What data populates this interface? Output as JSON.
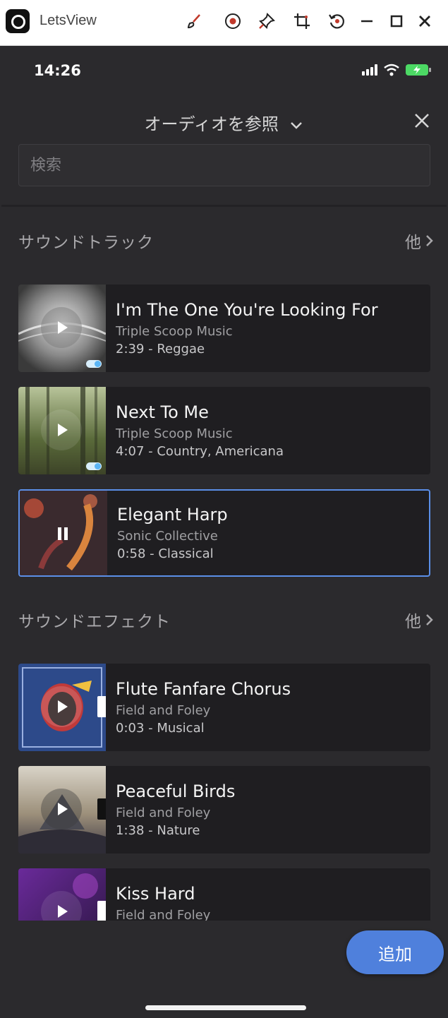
{
  "window": {
    "title": "LetsView",
    "toolbar_icons": [
      "brush-icon",
      "record-icon",
      "pin-icon",
      "crop-icon",
      "rotate-icon",
      "minimize-icon",
      "maximize-icon",
      "close-icon"
    ]
  },
  "status": {
    "time": "14:26"
  },
  "header": {
    "title": "オーディオを参照",
    "close_icon": "close-icon"
  },
  "search": {
    "placeholder": "検索",
    "value": ""
  },
  "soundtracks": {
    "title": "サウンドトラック",
    "more": "他",
    "items": [
      {
        "title": "I'm The One You're Looking For",
        "artist": "Triple Scoop Music",
        "meta": "2:39 - Reggae",
        "state": "play"
      },
      {
        "title": "Next To Me",
        "artist": "Triple Scoop Music",
        "meta": "4:07 - Country, Americana",
        "state": "play"
      },
      {
        "title": "Elegant Harp",
        "artist": "Sonic Collective",
        "meta": "0:58 - Classical",
        "state": "pause",
        "selected": true
      }
    ]
  },
  "sound_effects": {
    "title": "サウンドエフェクト",
    "more": "他",
    "items": [
      {
        "title": "Flute Fanfare Chorus",
        "artist": "Field and Foley",
        "meta": "0:03 - Musical",
        "state": "play"
      },
      {
        "title": "Peaceful Birds",
        "artist": "Field and Foley",
        "meta": "1:38 - Nature",
        "state": "play"
      },
      {
        "title": "Kiss Hard",
        "artist": "Field and Foley",
        "meta": "",
        "state": "play"
      }
    ]
  },
  "actions": {
    "add_label": "追加"
  },
  "colors": {
    "accent": "#4f80dc",
    "selected_border": "#5b8fe8",
    "background": "#2b2a2d",
    "card": "#1f1e21"
  }
}
